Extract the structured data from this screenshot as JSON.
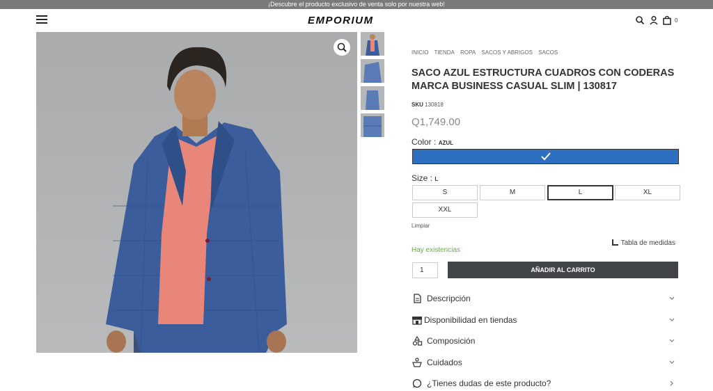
{
  "announcement": "¡Descubre el producto exclusivo de venta solo por nuestra web!",
  "header": {
    "logo": "EMPORIUM",
    "cart_count": "0",
    "icons": [
      "menu-icon",
      "search-icon",
      "user-icon",
      "cart-icon"
    ]
  },
  "gallery": {
    "thumbnails": [
      "thumb-front",
      "thumb-side",
      "thumb-back",
      "thumb-detail"
    ],
    "zoom_icon": "zoom-icon"
  },
  "breadcrumb": [
    "Inicio",
    "Tienda",
    "Ropa",
    "Sacos y abrigos",
    "Sacos"
  ],
  "product": {
    "title": "Saco azul estructura cuadros con coderas marca business casual slim | 130817",
    "sku_label": "SKU",
    "sku_value": "130818",
    "price": "Q1,749.00"
  },
  "color": {
    "label": "Color :",
    "selected": "AZUL",
    "swatch_color": "#2d6fc0"
  },
  "size": {
    "label": "Size :",
    "selected": "L",
    "options": [
      "S",
      "M",
      "L",
      "XL",
      "XXL"
    ]
  },
  "clear_label": "Limpiar",
  "size_chart_label": "Tabla de medidas",
  "stock_status": "Hay existencias",
  "quantity": "1",
  "add_to_cart": "Añadir al carrito",
  "accordion": [
    {
      "label": "Descripción",
      "icon": "document-icon"
    },
    {
      "label": "Disponibilidad en tiendas",
      "icon": "store-icon"
    },
    {
      "label": "Composición",
      "icon": "shapes-icon"
    },
    {
      "label": "Cuidados",
      "icon": "care-icon"
    },
    {
      "label": "¿Tienes dudas de este producto?",
      "icon": "whatsapp-icon"
    }
  ],
  "colors": {
    "announcement_bg": "#7a7a7a",
    "accent_green": "#6aa84f",
    "button_dark": "#414548"
  }
}
